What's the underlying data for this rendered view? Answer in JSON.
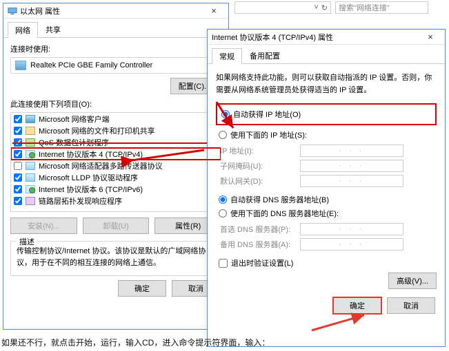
{
  "topbar": {
    "refresh_icon": "↻",
    "search_placeholder": "搜索\"网络连接\""
  },
  "leftWin": {
    "title": "以太网 属性",
    "close": "×",
    "tabs": {
      "network": "网络",
      "share": "共享"
    },
    "connect_label": "连接时使用:",
    "adapter_name": "Realtek PCIe GBE Family Controller",
    "configure_btn": "配置(C)...",
    "list_label": "此连接使用下列项目(O):",
    "items": [
      {
        "label": "Microsoft 网络客户端",
        "iconClass": "mi-client",
        "checked": true,
        "strike": false
      },
      {
        "label": "Microsoft 网络的文件和打印机共享",
        "iconClass": "mi-share",
        "checked": true,
        "strike": false
      },
      {
        "label": "QoS 数据包计划程序",
        "iconClass": "mi-qos",
        "checked": true,
        "strike": true
      },
      {
        "label": "Internet 协议版本 4 (TCP/IPv4)",
        "iconClass": "mi-proto",
        "checked": true,
        "highlight": true
      },
      {
        "label": "Microsoft 网络适配器多路传送器协议",
        "iconClass": "mi-driver",
        "checked": false
      },
      {
        "label": "Microsoft LLDP 协议驱动程序",
        "iconClass": "mi-driver",
        "checked": true
      },
      {
        "label": "Internet 协议版本 6 (TCP/IPv6)",
        "iconClass": "mi-proto",
        "checked": true
      },
      {
        "label": "链路层拓扑发现响应程序",
        "iconClass": "mi-link",
        "checked": true
      }
    ],
    "install_btn": "安装(N)...",
    "uninstall_btn": "卸载(U)",
    "properties_btn": "属性(R)",
    "desc_legend": "描述",
    "desc_text": "传输控制协议/Internet 协议。该协议是默认的广域网络协议，用于在不同的相互连接的网络上通信。",
    "ok": "确定",
    "cancel": "取消"
  },
  "rightWin": {
    "title": "Internet 协议版本 4 (TCP/IPv4) 属性",
    "close": "×",
    "tabs": {
      "general": "常规",
      "alt": "备用配置"
    },
    "intro": "如果网络支持此功能，则可以获取自动指派的 IP 设置。否则，你需要从网络系统管理员处获得适当的 IP 设置。",
    "auto_ip": "自动获得 IP 地址(O)",
    "manual_ip": "使用下面的 IP 地址(S):",
    "ip_label": "IP 地址(I):",
    "mask_label": "子网掩码(U):",
    "gw_label": "默认网关(D):",
    "auto_dns": "自动获得 DNS 服务器地址(B)",
    "manual_dns": "使用下面的 DNS 服务器地址(E):",
    "dns1_label": "首选 DNS 服务器(P):",
    "dns2_label": "备用 DNS 服务器(A):",
    "ip_placeholder": "· · ·",
    "exit_validate": "退出时验证设置(L)",
    "advanced": "高级(V)...",
    "ok": "确定",
    "cancel": "取消"
  },
  "footer": "如果还不行，就点击开始，运行，输入CD，进入命令提示符界面，输入："
}
